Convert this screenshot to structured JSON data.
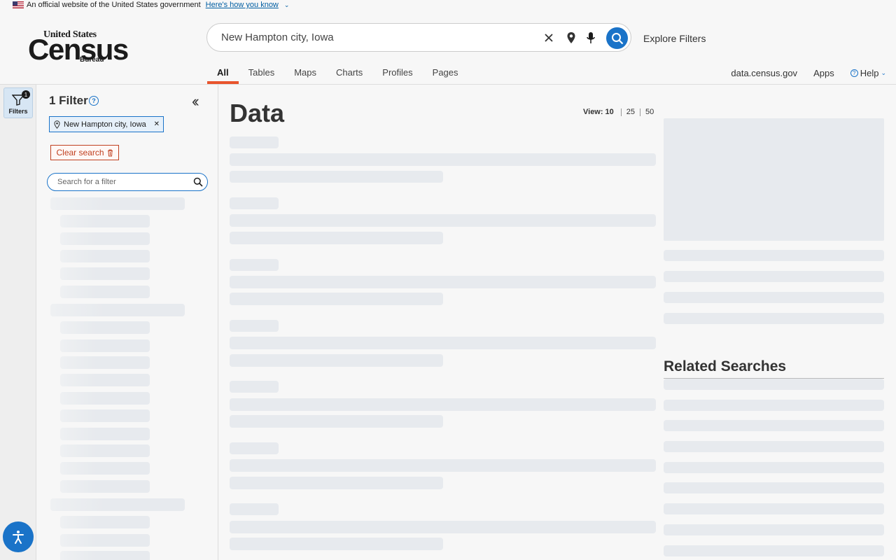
{
  "gov_banner": {
    "text": "An official website of the United States government",
    "link": "Here's how you know"
  },
  "logo": {
    "line1": "United States",
    "line2": "Census",
    "line3": "Bureau"
  },
  "search": {
    "query": "New Hampton city, Iowa"
  },
  "explore_filters": "Explore Filters",
  "tabs": [
    "All",
    "Tables",
    "Maps",
    "Charts",
    "Profiles",
    "Pages"
  ],
  "active_tab": "All",
  "right_links": {
    "site": "data.census.gov",
    "apps": "Apps",
    "help": "Help"
  },
  "rail": {
    "filters_label": "Filters",
    "filter_count": "1"
  },
  "filter_panel": {
    "title": "1 Filter",
    "chip_label": "New Hampton city, Iowa",
    "clear_label": "Clear search",
    "search_placeholder": "Search for a filter"
  },
  "main": {
    "heading": "Data",
    "view_label": "View:",
    "view_options": [
      "10",
      "25",
      "50"
    ],
    "related_heading": "Related Searches"
  },
  "colors": {
    "accent": "#1a73c8",
    "tab_underline": "#e8542d",
    "clear_red": "#c04020",
    "skeleton": "#e7eaee"
  }
}
